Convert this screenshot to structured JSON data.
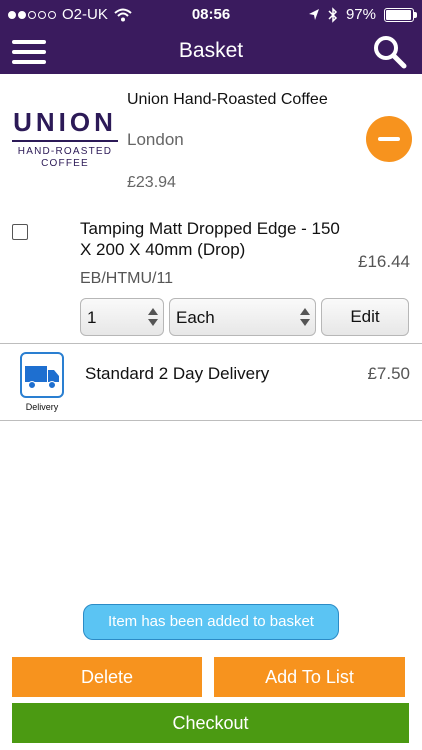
{
  "status_bar": {
    "carrier": "O2-UK",
    "time": "08:56",
    "battery": "97%",
    "battery_level": 0.97
  },
  "nav": {
    "title": "Basket"
  },
  "supplier": {
    "logo_word": "UNION",
    "logo_sub_1": "HAND-ROASTED",
    "logo_sub_2": "COFFEE",
    "name": "Union Hand-Roasted Coffee",
    "location": "London",
    "total": "£23.94"
  },
  "product": {
    "name": "Tamping Matt Dropped Edge - 150 X 200 X 40mm (Drop)",
    "price": "£16.44",
    "code": "EB/HTMU/11",
    "quantity": "1",
    "unit": "Each",
    "edit_label": "Edit"
  },
  "delivery": {
    "icon_label": "Delivery",
    "name": "Standard 2 Day Delivery",
    "price": "£7.50"
  },
  "toast": {
    "message": "Item has been added to basket"
  },
  "actions": {
    "delete_label": "Delete",
    "add_to_list_label": "Add To List",
    "checkout_label": "Checkout"
  },
  "colors": {
    "header": "#3a1b5e",
    "accent_orange": "#f7931e",
    "checkout_green": "#4b9a12",
    "toast_blue": "#5bc4f3"
  }
}
